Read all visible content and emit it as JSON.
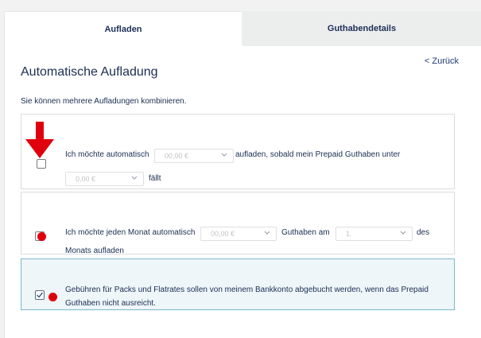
{
  "tabs": [
    {
      "label": "Aufladen",
      "active": true
    },
    {
      "label": "Guthabendetails",
      "active": false
    }
  ],
  "back_link": "< Zurück",
  "page_title": "Automatische Aufladung",
  "hint": "Sie können mehrere Aufladungen kombinieren.",
  "option1": {
    "text_a": "Ich möchte automatisch",
    "select_amount": "00,00 €",
    "text_b": "aufladen, sobald mein Prepaid Guthaben unter",
    "select_threshold": "0,00 €",
    "text_c": "fällt",
    "checked": false
  },
  "option2": {
    "text_a": "Ich möchte jeden Monat automatisch",
    "select_amount": "00,00 €",
    "text_b": "Guthaben am",
    "select_day": "1.",
    "text_c": "des",
    "text_d": "Monats aufladen",
    "checked": false
  },
  "option3": {
    "line1": "Gebühren für Packs und Flatrates sollen von meinem Bankkonto abgebucht werden, wenn das Prepaid",
    "line2": "Guthaben nicht ausreicht.",
    "checked": true
  },
  "colors": {
    "annotation": "#e0000d",
    "accent": "#1d2f57",
    "selected_card": "#eef6f9"
  }
}
